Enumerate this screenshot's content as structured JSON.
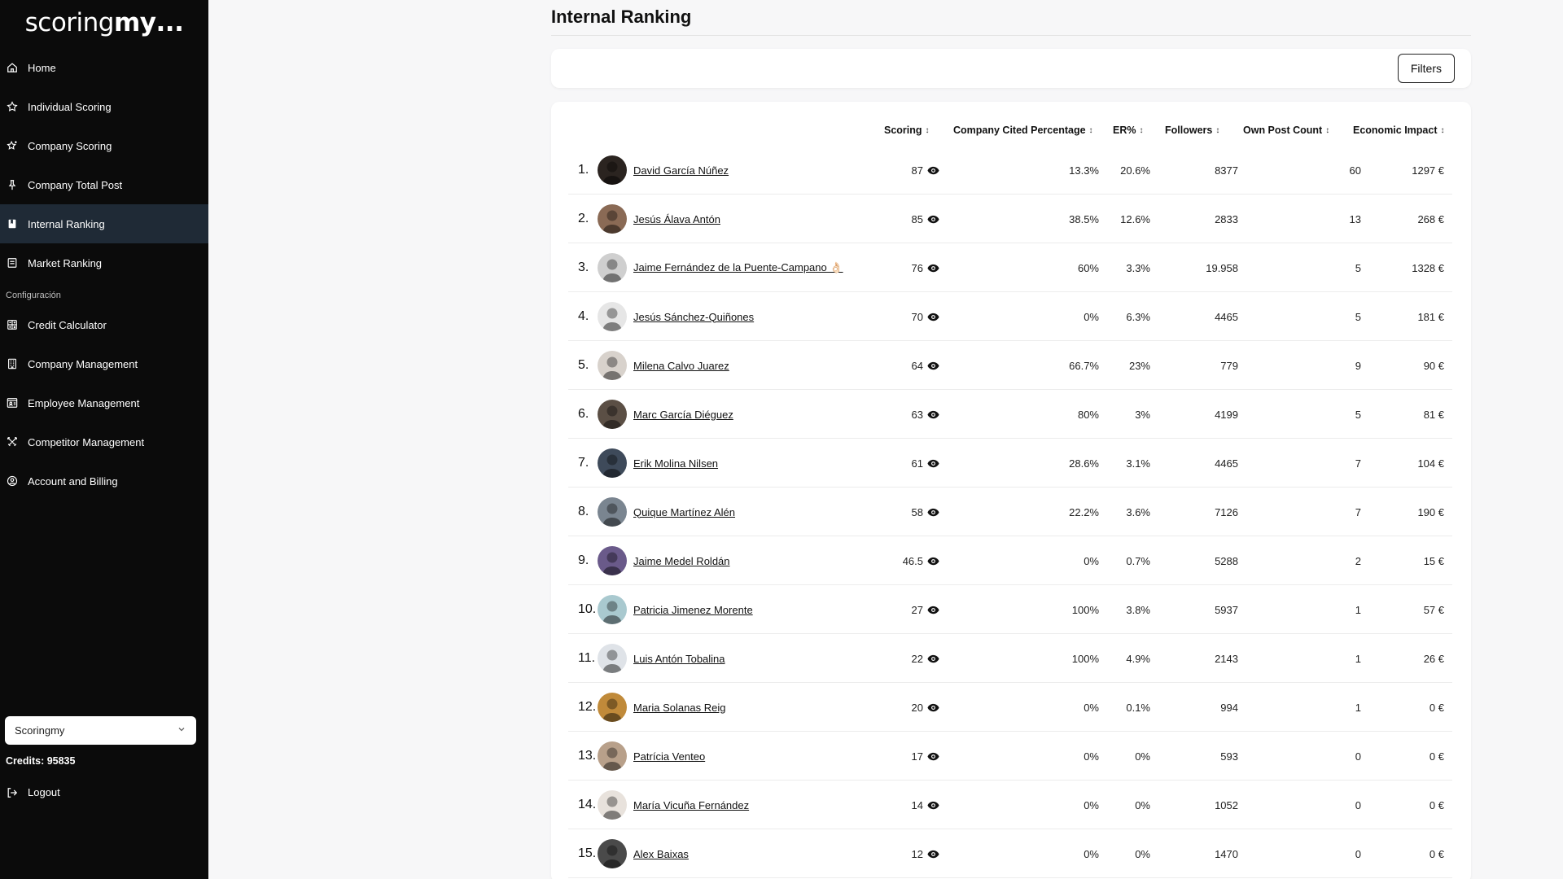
{
  "app": {
    "logo": {
      "light": "scoring",
      "bold": "my",
      "suffix": "..."
    }
  },
  "sidebar": {
    "items": [
      {
        "label": "Home",
        "icon": "home-icon"
      },
      {
        "label": "Individual Scoring",
        "icon": "star-icon"
      },
      {
        "label": "Company Scoring",
        "icon": "star-sparkle-icon"
      },
      {
        "label": "Company Total Post",
        "icon": "pin-icon"
      },
      {
        "label": "Internal Ranking",
        "icon": "bookmark-icon",
        "active": true
      },
      {
        "label": "Market Ranking",
        "icon": "list-icon"
      }
    ],
    "section_label": "Configuración",
    "config_items": [
      {
        "label": "Credit Calculator",
        "icon": "calculator-icon"
      },
      {
        "label": "Company Management",
        "icon": "building-icon"
      },
      {
        "label": "Employee Management",
        "icon": "id-card-icon"
      },
      {
        "label": "Competitor Management",
        "icon": "swords-icon"
      },
      {
        "label": "Account and Billing",
        "icon": "user-circle-icon"
      }
    ],
    "company_select": {
      "value": "Scoringmy"
    },
    "credits": "Credits: 95835",
    "logout": "Logout"
  },
  "main": {
    "title": "Internal Ranking",
    "filters_label": "Filters",
    "columns": {
      "scoring": "Scoring",
      "cited": "Company Cited Percentage",
      "er": "ER%",
      "followers": "Followers",
      "own_posts": "Own Post Count",
      "impact": "Economic Impact"
    },
    "rows": [
      {
        "rank": "1.",
        "name": "David García Núñez",
        "scoring": "87",
        "cited": "13.3%",
        "er": "20.6%",
        "followers": "8377",
        "own_posts": "60",
        "impact": "1297 €",
        "avatar_color": "#2b2420"
      },
      {
        "rank": "2.",
        "name": "Jesús Álava Antón",
        "scoring": "85",
        "cited": "38.5%",
        "er": "12.6%",
        "followers": "2833",
        "own_posts": "13",
        "impact": "268 €",
        "avatar_color": "#8a6a55"
      },
      {
        "rank": "3.",
        "name": "Jaime Fernández de la Puente-Campano 👌🏻",
        "scoring": "76",
        "cited": "60%",
        "er": "3.3%",
        "followers": "19.958",
        "own_posts": "5",
        "impact": "1328 €",
        "avatar_color": "#cfcfcf"
      },
      {
        "rank": "4.",
        "name": "Jesús Sánchez-Quiñones",
        "scoring": "70",
        "cited": "0%",
        "er": "6.3%",
        "followers": "4465",
        "own_posts": "5",
        "impact": "181 €",
        "avatar_color": "#e6e6e6"
      },
      {
        "rank": "5.",
        "name": "Milena Calvo Juarez",
        "scoring": "64",
        "cited": "66.7%",
        "er": "23%",
        "followers": "779",
        "own_posts": "9",
        "impact": "90 €",
        "avatar_color": "#d8d2cc"
      },
      {
        "rank": "6.",
        "name": "Marc García Diéguez",
        "scoring": "63",
        "cited": "80%",
        "er": "3%",
        "followers": "4199",
        "own_posts": "5",
        "impact": "81 €",
        "avatar_color": "#5b4f45"
      },
      {
        "rank": "7.",
        "name": "Erik Molina Nilsen",
        "scoring": "61",
        "cited": "28.6%",
        "er": "3.1%",
        "followers": "4465",
        "own_posts": "7",
        "impact": "104 €",
        "avatar_color": "#3e4a5a"
      },
      {
        "rank": "8.",
        "name": "Quique Martínez Alén",
        "scoring": "58",
        "cited": "22.2%",
        "er": "3.6%",
        "followers": "7126",
        "own_posts": "7",
        "impact": "190 €",
        "avatar_color": "#7a8590"
      },
      {
        "rank": "9.",
        "name": "Jaime Medel Roldán",
        "scoring": "46.5",
        "cited": "0%",
        "er": "0.7%",
        "followers": "5288",
        "own_posts": "2",
        "impact": "15 €",
        "avatar_color": "#6a5a8a"
      },
      {
        "rank": "10.",
        "name": "Patricia Jimenez Morente",
        "scoring": "27",
        "cited": "100%",
        "er": "3.8%",
        "followers": "5937",
        "own_posts": "1",
        "impact": "57 €",
        "avatar_color": "#a9c9cf"
      },
      {
        "rank": "11.",
        "name": "Luis Antón Tobalina",
        "scoring": "22",
        "cited": "100%",
        "er": "4.9%",
        "followers": "2143",
        "own_posts": "1",
        "impact": "26 €",
        "avatar_color": "#dfe3e8"
      },
      {
        "rank": "12.",
        "name": "Maria Solanas Reig",
        "scoring": "20",
        "cited": "0%",
        "er": "0.1%",
        "followers": "994",
        "own_posts": "1",
        "impact": "0 €",
        "avatar_color": "#c08a3a"
      },
      {
        "rank": "13.",
        "name": "Patrícia Venteo",
        "scoring": "17",
        "cited": "0%",
        "er": "0%",
        "followers": "593",
        "own_posts": "0",
        "impact": "0 €",
        "avatar_color": "#b8a08a"
      },
      {
        "rank": "14.",
        "name": "María Vicuña Fernández",
        "scoring": "14",
        "cited": "0%",
        "er": "0%",
        "followers": "1052",
        "own_posts": "0",
        "impact": "0 €",
        "avatar_color": "#e8e2dc"
      },
      {
        "rank": "15.",
        "name": "Alex Baixas",
        "scoring": "12",
        "cited": "0%",
        "er": "0%",
        "followers": "1470",
        "own_posts": "0",
        "impact": "0 €",
        "avatar_color": "#4a4a4a"
      }
    ]
  }
}
